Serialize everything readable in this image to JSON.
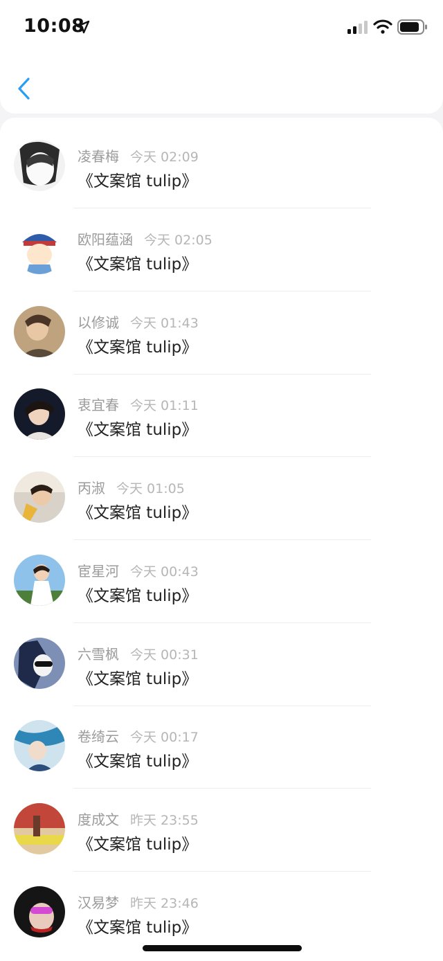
{
  "status_bar": {
    "time": "10:08",
    "icons": [
      "location-arrow-icon",
      "cellular-signal-icon",
      "wifi-icon",
      "battery-icon"
    ]
  },
  "nav": {
    "back_icon": "chevron-left-icon",
    "accent_color": "#2a9df4"
  },
  "comments": [
    {
      "name": "凌春梅",
      "time": "今天 02:09",
      "text": "《文案馆 tulip》",
      "avatar_color": "#d9d9d9"
    },
    {
      "name": "欧阳蕴涵",
      "time": "今天 02:05",
      "text": "《文案馆 tulip》",
      "avatar_color": "#2f5ca8"
    },
    {
      "name": "以修诚",
      "time": "今天 01:43",
      "text": "《文案馆 tulip》",
      "avatar_color": "#9c7a5a"
    },
    {
      "name": "衷宜春",
      "time": "今天 01:11",
      "text": "《文案馆 tulip》",
      "avatar_color": "#1d2336"
    },
    {
      "name": "丙淑",
      "time": "今天 01:05",
      "text": "《文案馆 tulip》",
      "avatar_color": "#6a5a4a"
    },
    {
      "name": "宦星河",
      "time": "今天 00:43",
      "text": "《文案馆 tulip》",
      "avatar_color": "#7fb3df"
    },
    {
      "name": "六雪枫",
      "time": "今天 00:31",
      "text": "《文案馆 tulip》",
      "avatar_color": "#26345c"
    },
    {
      "name": "卷绮云",
      "time": "今天 00:17",
      "text": "《文案馆 tulip》",
      "avatar_color": "#3a8fb8"
    },
    {
      "name": "度成文",
      "time": "昨天 23:55",
      "text": "《文案馆 tulip》",
      "avatar_color": "#c2473a"
    },
    {
      "name": "汉易梦",
      "time": "昨天 23:46",
      "text": "《文案馆 tulip》",
      "avatar_color": "#1a1a1a"
    }
  ]
}
